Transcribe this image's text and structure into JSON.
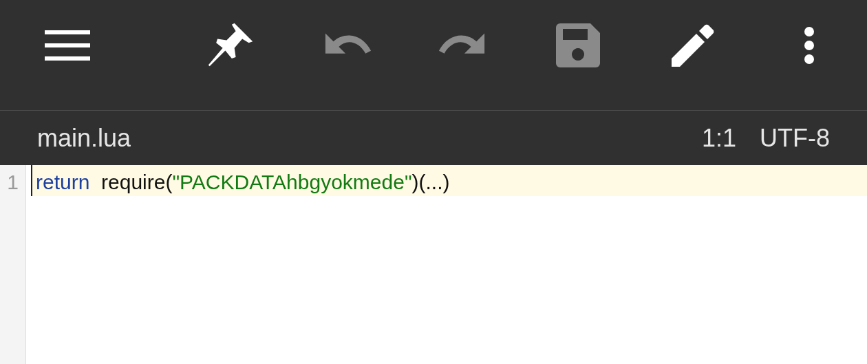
{
  "toolbar": [
    {
      "kind": "menu",
      "disabled": false
    },
    {
      "kind": "pin",
      "disabled": false
    },
    {
      "kind": "undo",
      "disabled": true
    },
    {
      "kind": "redo",
      "disabled": true
    },
    {
      "kind": "save",
      "disabled": true
    },
    {
      "kind": "edit",
      "disabled": false
    },
    {
      "kind": "more",
      "disabled": false
    }
  ],
  "file_bar": {
    "filename": "main.lua",
    "cursor_position": "1:1",
    "encoding": "UTF-8"
  },
  "editor": {
    "lines": [
      {
        "number": "1",
        "current": true,
        "tokens": [
          {
            "kind": "keyword",
            "text": "return"
          },
          {
            "kind": "plain",
            "text": "  require("
          },
          {
            "kind": "string",
            "text": "\"PACKDATAhbgyokmede\""
          },
          {
            "kind": "plain",
            "text": ")(...)"
          }
        ]
      }
    ]
  }
}
